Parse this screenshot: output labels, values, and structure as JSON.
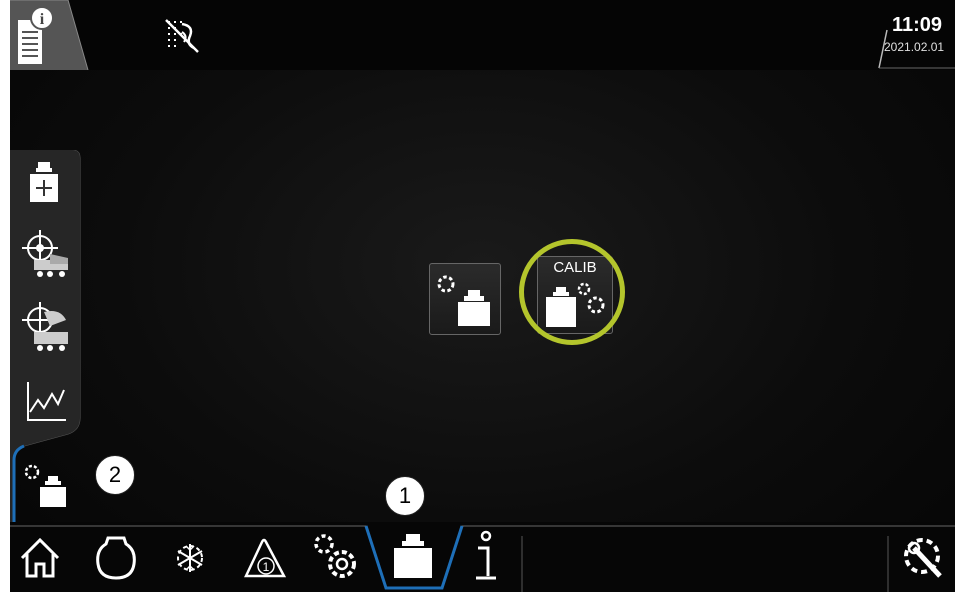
{
  "topbar": {
    "info_icon": "document-info-icon",
    "status_icon": "sensor-disabled-icon",
    "time": "11:09",
    "date": "2021.02.01"
  },
  "sidebar": {
    "items": [
      {
        "icon": "weight-add-icon"
      },
      {
        "icon": "target-truck-icon"
      },
      {
        "icon": "target-truck-load-icon"
      },
      {
        "icon": "chart-line-icon"
      },
      {
        "icon": "scale-settings-icon",
        "active": true
      }
    ]
  },
  "main": {
    "tiles": [
      {
        "icon": "scale-settings-icon"
      },
      {
        "icon": "calibration-icon",
        "label": "CALIB"
      }
    ],
    "highlight_color": "#b4c52c"
  },
  "bottom_nav": {
    "items": [
      {
        "icon": "home-icon"
      },
      {
        "icon": "drum-icon"
      },
      {
        "icon": "snowflake-gear-icon"
      },
      {
        "icon": "warning-1-icon"
      },
      {
        "icon": "gears-icon"
      },
      {
        "icon": "weight-icon",
        "active": true
      },
      {
        "icon": "info-icon"
      },
      {
        "icon": "wrench-gear-icon"
      }
    ],
    "accent_color": "#1e6fb8"
  },
  "callouts": [
    {
      "label": "1"
    },
    {
      "label": "2"
    }
  ]
}
